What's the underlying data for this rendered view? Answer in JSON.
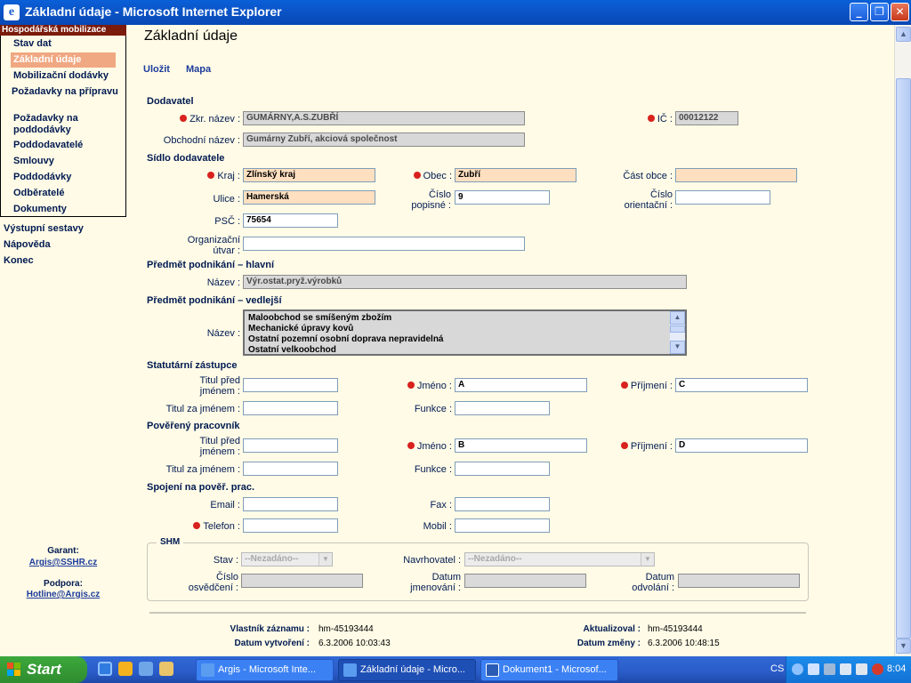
{
  "window": {
    "title": "Základní údaje - Microsoft Internet Explorer",
    "buttons": {
      "minimize": "_",
      "maximize": "❐",
      "close": "✕"
    }
  },
  "sidebar": {
    "header": "Hospodářská mobilizace",
    "items": [
      {
        "label": "Stav dat"
      },
      {
        "label": "Základní údaje",
        "active": true
      },
      {
        "label": "Mobilizační dodávky"
      },
      {
        "label": "Požadavky na přípravu"
      },
      {
        "label": "Požadavky na poddodávky"
      },
      {
        "label": "Poddodavatelé"
      },
      {
        "label": "Smlouvy"
      },
      {
        "label": "Poddodávky"
      },
      {
        "label": "Odběratelé"
      },
      {
        "label": "Dokumenty"
      }
    ],
    "top_items": [
      "Výstupní sestavy",
      "Nápověda",
      "Konec"
    ],
    "garant_label": "Garant:",
    "garant_email": "Argis@SSHR.cz",
    "podpora_label": "Podpora:",
    "podpora_email": "Hotline@Argis.cz"
  },
  "main": {
    "title": "Základní údaje",
    "actions": {
      "save": "Uložit",
      "map": "Mapa"
    },
    "sections": {
      "dodavatel": "Dodavatel",
      "sidlo": "Sídlo dodavatele",
      "predmet_hlavni": "Předmět podnikání – hlavní",
      "predmet_vedlejsi": "Předmět podnikání – vedlejší",
      "statutarni": "Statutární zástupce",
      "povereny": "Pověřený pracovník",
      "spojeni": "Spojení na pověř. prac.",
      "shm": "SHM"
    },
    "labels": {
      "zkr_nazev": "Zkr. název :",
      "ic": "IČ :",
      "obchodni_nazev": "Obchodní název :",
      "kraj": "Kraj :",
      "obec": "Obec :",
      "cast_obce": "Část obce :",
      "ulice": "Ulice :",
      "cislo_popisne": "Číslo popisné :",
      "cislo_orientacni": "Číslo orientační :",
      "psc": "PSČ :",
      "org_utvar": "Organizační útvar :",
      "nazev": "Název :",
      "titul_pred": "Titul před jménem :",
      "jmeno": "Jméno :",
      "prijmeni": "Příjmení :",
      "titul_za": "Titul za jménem :",
      "funkce": "Funkce :",
      "email": "Email :",
      "fax": "Fax :",
      "telefon": "Telefon :",
      "mobil": "Mobil :",
      "stav": "Stav :",
      "navrhovatel": "Navrhovatel :",
      "cislo_osvedceni": "Číslo osvědčení :",
      "datum_jmenovani": "Datum jmenování :",
      "datum_odvolani": "Datum odvolání :"
    },
    "values": {
      "zkr_nazev": "GUMÁRNY,A.S.ZUBŘÍ",
      "ic": "00012122",
      "obchodni_nazev": "Gumárny Zubří, akciová společnost",
      "kraj": "Zlínský kraj",
      "obec": "Zubří",
      "cast_obce": "",
      "ulice": "Hamerská",
      "cislo_popisne": "9",
      "cislo_orientacni": "",
      "psc": "75654",
      "org_utvar": "",
      "predmet_hlavni": "Výr.ostat.pryž.výrobků",
      "predmet_vedlejsi": [
        "Maloobchod se smíšeným zbožím",
        "Mechanické úpravy kovů",
        "Ostatní pozemní osobní doprava nepravidelná",
        "Ostatní velkoobchod"
      ],
      "stat_titul_pred": "",
      "stat_jmeno": "A",
      "stat_prijmeni": "C",
      "stat_titul_za": "",
      "stat_funkce": "",
      "pov_titul_pred": "",
      "pov_jmeno": "B",
      "pov_prijmeni": "D",
      "pov_titul_za": "",
      "pov_funkce": "",
      "email": "",
      "fax": "",
      "telefon": "",
      "mobil": "",
      "shm_stav": "--Nezadáno--",
      "shm_navrhovatel": "--Nezadáno--",
      "cislo_osvedceni": "",
      "datum_jmenovani": "",
      "datum_odvolani": ""
    },
    "meta": {
      "vlastnik_label": "Vlastník záznamu :",
      "vlastnik_value": "hm-45193444",
      "aktualizoval_label": "Aktualizoval :",
      "aktualizoval_value": "hm-45193444",
      "datum_vytvoreni_label": "Datum vytvoření :",
      "datum_vytvoreni_value": "6.3.2006 10:03:43",
      "datum_zmeny_label": "Datum změny :",
      "datum_zmeny_value": "6.3.2006 10:48:15"
    }
  },
  "taskbar": {
    "start": "Start",
    "tasks": [
      {
        "label": "Argis - Microsoft Inte...",
        "active": false
      },
      {
        "label": "Základní údaje - Micro...",
        "active": true
      },
      {
        "label": "Dokument1 - Microsof...",
        "active": false
      }
    ],
    "lang": "CS",
    "clock": "8:04"
  },
  "colors": {
    "page_bg": "#FFFBE6",
    "required_dot": "#D8221E",
    "nav_active": "#F0A882",
    "nav_header": "#7A1B0C",
    "link": "#1C3C9C"
  }
}
